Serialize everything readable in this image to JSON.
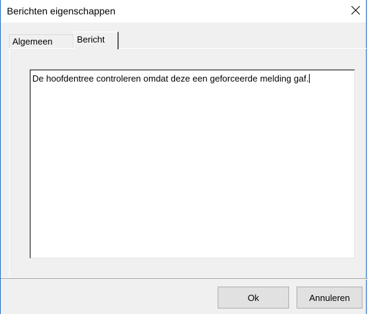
{
  "window": {
    "title": "Berichten eigenschappen"
  },
  "tabs": [
    {
      "label": "Algemeen",
      "active": false
    },
    {
      "label": "Bericht",
      "active": true
    }
  ],
  "message": {
    "text": "De hoofdentree controleren omdat deze een geforceerde melding gaf."
  },
  "buttons": {
    "ok_label": "Ok",
    "cancel_label": "Annuleren"
  },
  "icons": {
    "close": "close-icon"
  },
  "colors": {
    "window_border": "#1b6ac9",
    "face": "#f0f0f0",
    "button_face": "#e1e1e1"
  }
}
